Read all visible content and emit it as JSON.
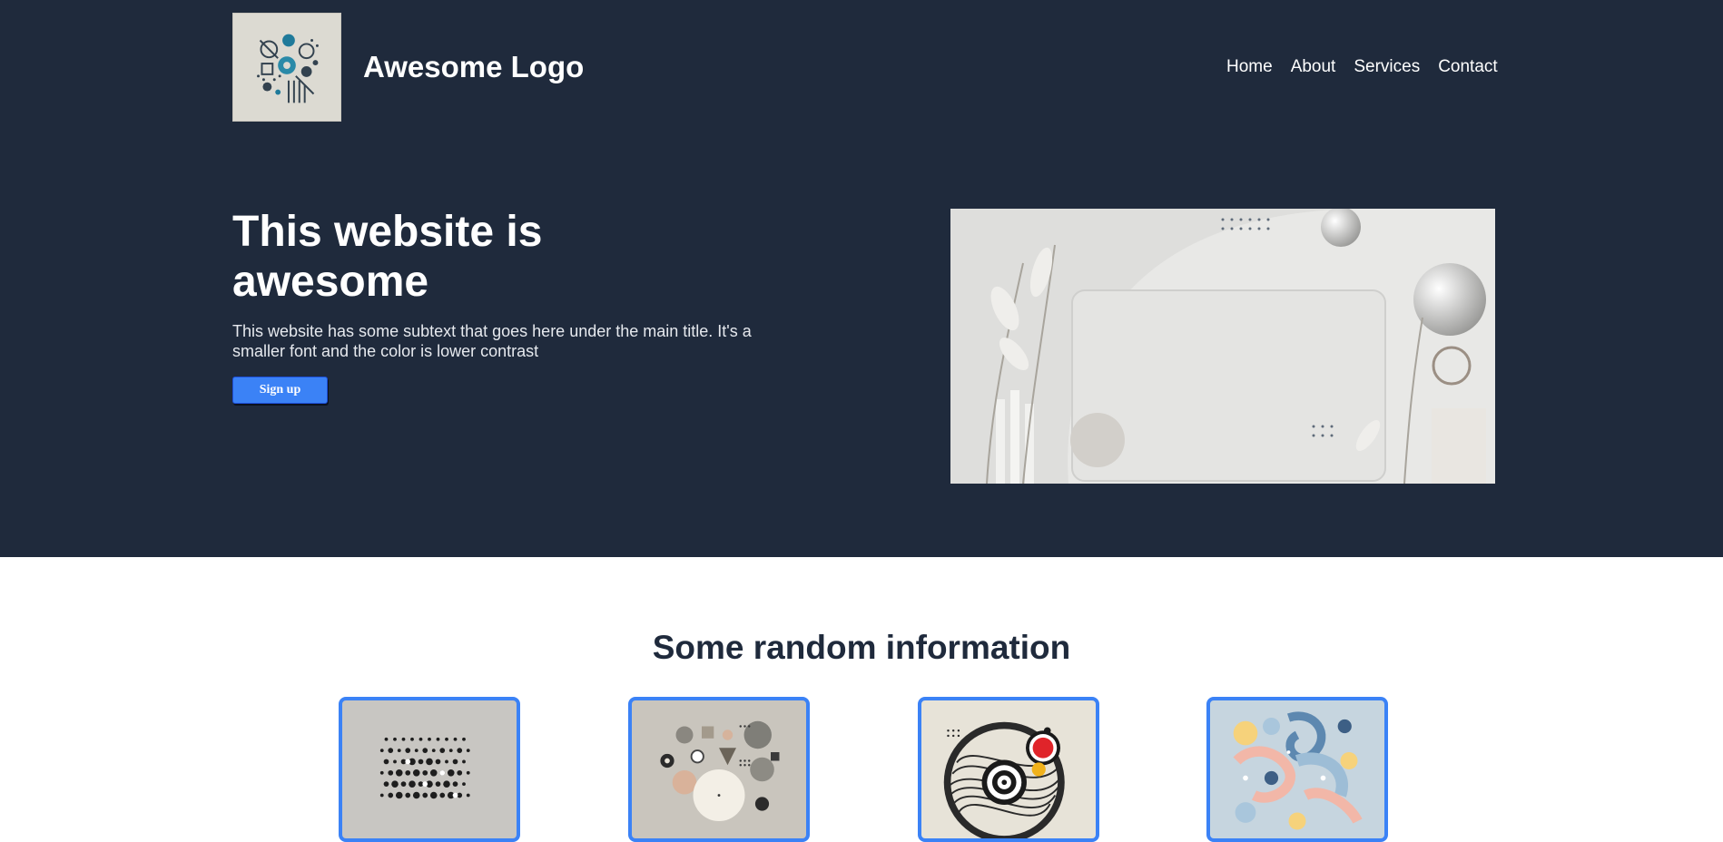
{
  "header": {
    "brand": "Awesome Logo",
    "logo_icon": "geometric-logo-icon",
    "nav": [
      {
        "label": "Home"
      },
      {
        "label": "About"
      },
      {
        "label": "Services"
      },
      {
        "label": "Contact"
      }
    ]
  },
  "hero": {
    "title": "This website is awesome",
    "subtext": "This website has some subtext that goes here under the main title. It's a smaller font and the color is lower contrast",
    "cta_label": "Sign up",
    "image": "abstract-white-still-life-image"
  },
  "info": {
    "title": "Some random information",
    "cards": [
      {
        "image": "dot-grid-art"
      },
      {
        "image": "geometric-shapes-art"
      },
      {
        "image": "concentric-circles-art"
      },
      {
        "image": "pastel-swirls-art"
      }
    ]
  },
  "colors": {
    "hero_bg": "#1f2a3c",
    "accent": "#3b82f6",
    "heading_dark": "#1f2a3c",
    "page_bg": "#ffffff"
  }
}
